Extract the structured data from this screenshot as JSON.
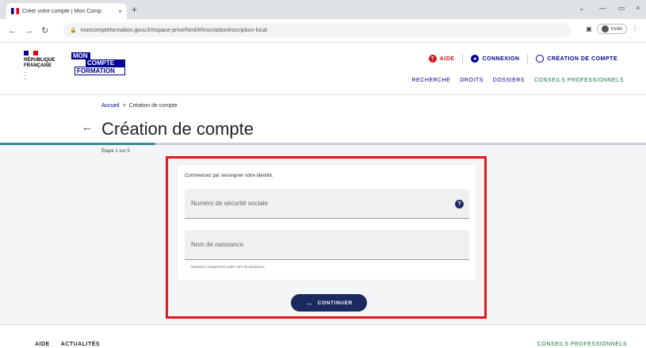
{
  "browser": {
    "tab_title": "Créer votre compte | Mon Comp",
    "tab_close": "×",
    "new_tab": "+",
    "url": "moncompteformation.gouv.fr/espace-prive/html/#/inscription/inscription-local",
    "profile_label": "Invité",
    "minimize": "—",
    "restore": "▭",
    "chevron": "⌄"
  },
  "header": {
    "republique_line1": "RÉPUBLIQUE",
    "republique_line2": "FRANÇAISE",
    "logo": [
      "MON",
      "COMPTE",
      "FORMATION"
    ],
    "links": {
      "help": "AIDE",
      "login": "CONNEXION",
      "create_account": "CRÉATION DE COMPTE"
    },
    "nav": [
      "RECHERCHE",
      "DROITS",
      "DOSSIERS",
      "CONSEILS PROFESSIONNELS"
    ]
  },
  "breadcrumb": {
    "home": "Accueil",
    "separator": ">",
    "current": "Création de compte"
  },
  "page": {
    "title": "Création de compte",
    "step": "Étape 1 sur 5",
    "step_progress": 0.24
  },
  "form": {
    "intro": "Commencez par renseigner votre identité.",
    "ssn_placeholder": "Numéro de sécurité sociale",
    "ssn_value": "",
    "birthname_placeholder": "Nom de naissance",
    "birthname_value": "",
    "birthname_hint": "Saisissez uniquement votre nom de naissance",
    "continue_label": "CONTINUER"
  },
  "footer": {
    "left": [
      "AIDE",
      "ACTUALITÉS"
    ],
    "right": "CONSEILS PROFESSIONNELS"
  },
  "colors": {
    "primary": "#000091",
    "navy_button": "#1a2a5e",
    "help_red": "#c9191e",
    "accent_green": "#18753c",
    "highlight": "#e1191b"
  }
}
